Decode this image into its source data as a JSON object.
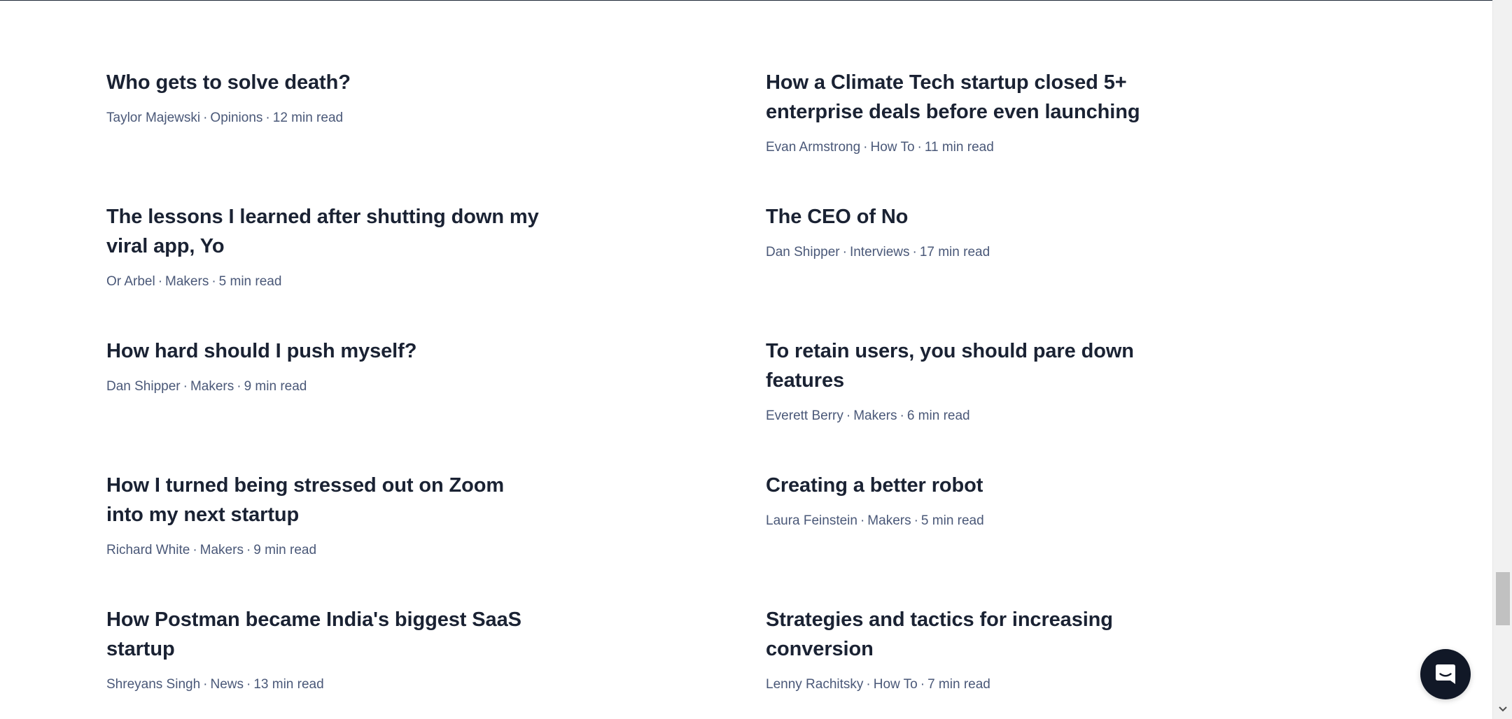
{
  "articles_left": [
    {
      "title": "Who gets to solve death?",
      "author": "Taylor Majewski",
      "category": "Opinions",
      "read_time": "12 min read"
    },
    {
      "title": "The lessons I learned after shutting down my viral app, Yo",
      "author": "Or Arbel",
      "category": "Makers",
      "read_time": "5 min read"
    },
    {
      "title": "How hard should I push myself?",
      "author": "Dan Shipper",
      "category": "Makers",
      "read_time": "9 min read"
    },
    {
      "title": "How I turned being stressed out on Zoom into my next startup",
      "author": "Richard White",
      "category": "Makers",
      "read_time": "9 min read"
    },
    {
      "title": "How Postman became India's biggest SaaS startup",
      "author": "Shreyans Singh",
      "category": "News",
      "read_time": "13 min read"
    }
  ],
  "articles_right": [
    {
      "title": "How a Climate Tech startup closed 5+ enterprise deals before even launching",
      "author": "Evan Armstrong",
      "category": "How To",
      "read_time": "11 min read"
    },
    {
      "title": "The CEO of No",
      "author": "Dan Shipper",
      "category": "Interviews",
      "read_time": "17 min read"
    },
    {
      "title": "To retain users, you should pare down features",
      "author": "Everett Berry",
      "category": "Makers",
      "read_time": "6 min read"
    },
    {
      "title": "Creating a better robot",
      "author": "Laura Feinstein",
      "category": "Makers",
      "read_time": "5 min read"
    },
    {
      "title": "Strategies and tactics for increasing conversion",
      "author": "Lenny Rachitsky",
      "category": "How To",
      "read_time": "7 min read"
    }
  ],
  "meta_separator": "·",
  "colors": {
    "title": "#1a2233",
    "meta": "#4a5878",
    "chat_launcher": "#111827"
  },
  "icons": {
    "chat": "chat-bubble-icon",
    "scroll_down": "chevron-down-icon"
  }
}
